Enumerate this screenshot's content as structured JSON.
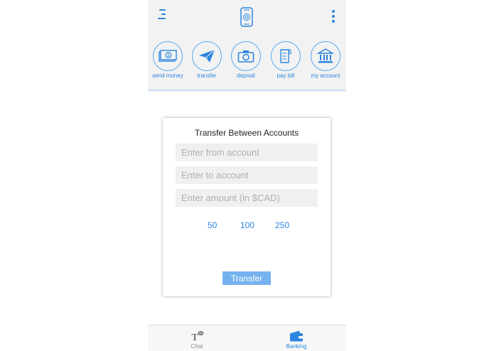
{
  "colors": {
    "accent": "#2b86e0",
    "button": "#75b2ef",
    "header_bg": "#f2f2f2"
  },
  "header": {
    "menu_icon": "hamburger-menu-icon",
    "logo_icon": "phone-logo-icon",
    "more_icon": "kebab-menu-icon"
  },
  "actions": [
    {
      "label": "send money",
      "icon": "cash-icon"
    },
    {
      "label": "transfer",
      "icon": "paper-plane-icon"
    },
    {
      "label": "deposit",
      "icon": "camera-icon"
    },
    {
      "label": "pay bill",
      "icon": "bill-icon"
    },
    {
      "label": "my account",
      "icon": "bank-icon"
    }
  ],
  "card": {
    "title": "Transfer Between Accounts",
    "from_placeholder": "Enter from account",
    "to_placeholder": "Enter to account",
    "amount_placeholder": "Enter amount (in $CAD)",
    "quick_amounts": [
      "50",
      "100",
      "250"
    ],
    "submit_label": "Transfer"
  },
  "tabbar": {
    "tabs": [
      {
        "label": "Chat",
        "icon": "chat-icon",
        "active": false
      },
      {
        "label": "Banking",
        "icon": "wallet-icon",
        "active": true
      }
    ]
  }
}
